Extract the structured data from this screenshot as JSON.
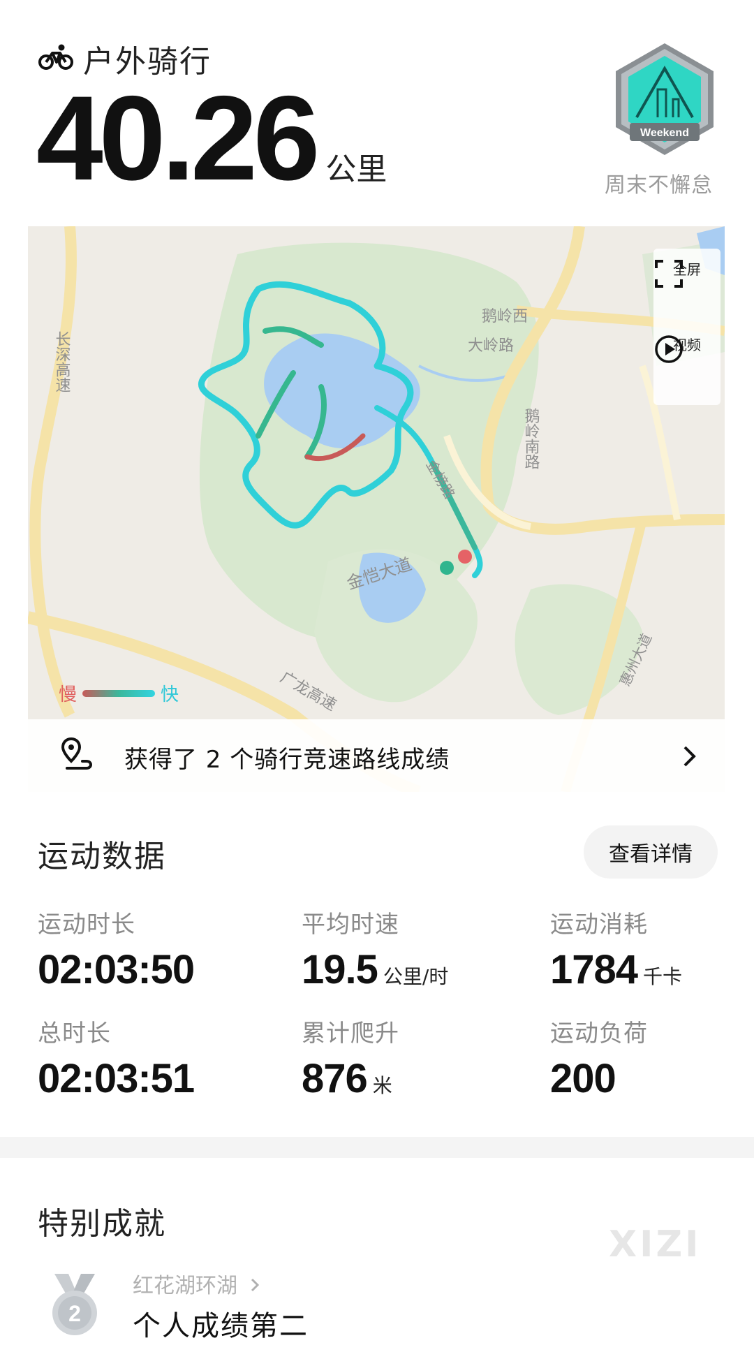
{
  "header": {
    "sport_title": "户外骑行",
    "distance_value": "40.26",
    "distance_unit": "公里",
    "badge_label": "Weekend",
    "badge_caption": "周末不懈怠"
  },
  "map": {
    "controls": {
      "fullscreen_label": "全屏",
      "video_label": "视频"
    },
    "legend": {
      "slow": "慢",
      "fast": "快"
    },
    "labels": {
      "road_changshen": "长深高速",
      "road_eling_west": "鹅岭西",
      "road_daling": "大岭路",
      "road_eling_south": "鹅岭南路",
      "road_jinkai": "金恺大道",
      "road_guanglong": "广龙高速",
      "road_jinbang": "金榜路",
      "road_huizhou": "惠州大道"
    },
    "segment_message": "获得了 2 个骑行竞速路线成绩"
  },
  "stats": {
    "section_title": "运动数据",
    "detail_button": "查看详情",
    "items": [
      {
        "label": "运动时长",
        "value": "02:03:50",
        "unit": ""
      },
      {
        "label": "平均时速",
        "value": "19.5",
        "unit": "公里/时"
      },
      {
        "label": "运动消耗",
        "value": "1784",
        "unit": "千卡"
      },
      {
        "label": "总时长",
        "value": "02:03:51",
        "unit": ""
      },
      {
        "label": "累计爬升",
        "value": "876",
        "unit": "米"
      },
      {
        "label": "运动负荷",
        "value": "200",
        "unit": ""
      }
    ]
  },
  "achievements": {
    "section_title": "特别成就",
    "medal_rank": "2",
    "route_name": "红花湖环湖",
    "result": "个人成绩第二"
  },
  "watermark": "XIZI",
  "colors": {
    "track_fast": "#2fd0d8",
    "track_mid": "#36b78f",
    "track_slow": "#c85a58",
    "water": "#a9cdf2",
    "park": "#d8e8cf"
  }
}
